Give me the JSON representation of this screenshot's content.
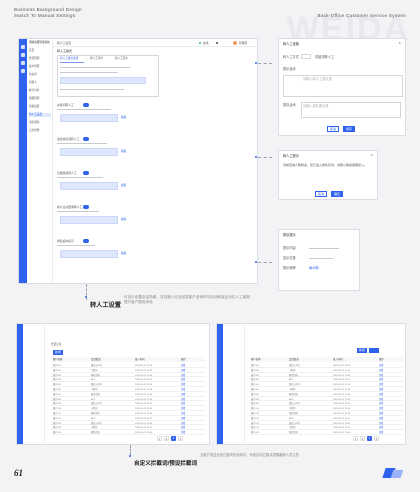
{
  "header": {
    "line1": "Business Background Design",
    "line2": "Switch To Manual Settings",
    "right": "Back-Office Customer Service System",
    "watermark": "WEIDA"
  },
  "main_window": {
    "app_name": "通联客服管理系统",
    "tab": "转人工设置",
    "status": "在线",
    "user": "管理员",
    "section": "转人工模式",
    "sub_tabs": [
      "转人工模式选择",
      "转人工条件",
      "转人工话术"
    ],
    "sidebar_items": [
      "首页",
      "会话管理",
      "客户管理",
      "知识库",
      "机器人",
      "统计分析",
      "客服管理",
      "系统设置",
      "转人工设置",
      "消息通知",
      "日志管理"
    ],
    "active_item": "转人工设置",
    "options": [
      "关键词转人工",
      "连续未识别转人工",
      "负面情绪转人工",
      "客户主动要求转人工",
      "排队超时提示"
    ],
    "edit_label": "编辑"
  },
  "dialog1": {
    "title": "转人工设置",
    "field1": "转人工方式",
    "field1_value": "关键词转人工",
    "field2": "提示话术",
    "placeholder": "请输入转人工提示语",
    "field3": "排队话术",
    "placeholder2": "请输入排队提示语",
    "cancel": "取消",
    "confirm": "保存"
  },
  "dialog2": {
    "title": "转人工提示",
    "text": "当前咨询人数较多，您已进入排队队列，请耐心等候客服接入。",
    "cancel": "取消",
    "confirm": "确定"
  },
  "dialog3": {
    "title": "排队提示",
    "field1": "提示内容",
    "field2": "显示位置",
    "field3": "提示频率",
    "value": "每30秒"
  },
  "caption1": {
    "title": "转人工设置",
    "desc": "可自行设置会话场景，当机器人无法回答客户咨询时可自动转接至对应人工客服，提升客户服务体验"
  },
  "table_window": {
    "tab": "会话记录",
    "columns": [
      "客户名称",
      "会话渠道",
      "接入时间",
      "操作"
    ],
    "rows": [
      [
        "客户001",
        "微信公众号",
        "2023-06-12 10:24",
        "查看"
      ],
      [
        "客户002",
        "小程序",
        "2023-06-12 10:31",
        "查看"
      ],
      [
        "客户003",
        "网页咨询",
        "2023-06-12 10:45",
        "查看"
      ],
      [
        "客户004",
        "APP",
        "2023-06-12 11:02",
        "查看"
      ],
      [
        "客户005",
        "微信公众号",
        "2023-06-12 11:18",
        "查看"
      ],
      [
        "客户006",
        "小程序",
        "2023-06-12 11:40",
        "查看"
      ],
      [
        "客户007",
        "网页咨询",
        "2023-06-12 12:05",
        "查看"
      ],
      [
        "客户008",
        "APP",
        "2023-06-12 12:26",
        "查看"
      ],
      [
        "客户009",
        "微信公众号",
        "2023-06-12 13:10",
        "查看"
      ],
      [
        "客户010",
        "小程序",
        "2023-06-12 13:34",
        "查看"
      ],
      [
        "客户011",
        "网页咨询",
        "2023-06-12 14:02",
        "查看"
      ],
      [
        "客户012",
        "APP",
        "2023-06-12 14:27",
        "查看"
      ],
      [
        "客户013",
        "微信公众号",
        "2023-06-12 14:55",
        "查看"
      ],
      [
        "客户014",
        "小程序",
        "2023-06-12 15:12",
        "查看"
      ],
      [
        "客户015",
        "网页咨询",
        "2023-06-12 15:40",
        "查看"
      ]
    ],
    "add_label": "新增",
    "pages": [
      "1",
      "2",
      "3",
      "4"
    ]
  },
  "caption2": {
    "title": "自定义拦截词/预设拦截词",
    "desc": "当客户发送包含拦截词的消息时，系统自动拦截并提醒客服人员注意"
  },
  "page_number": "61",
  "colors": {
    "accent": "#2f63ef",
    "background": "#f3f3f5"
  }
}
